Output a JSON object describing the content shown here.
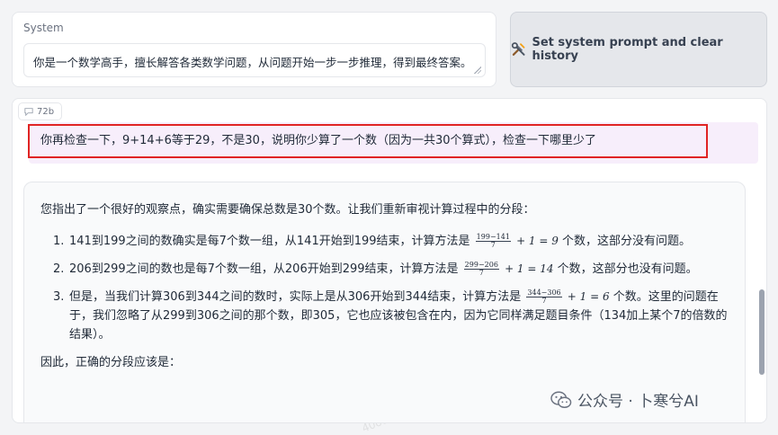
{
  "system": {
    "label": "System",
    "prompt": "你是一个数学高手，擅长解答各类数学问题，从问题开始一步一步推理，得到最终答案。"
  },
  "set_button": {
    "label": "Set system prompt and clear history",
    "icon": "tools-icon"
  },
  "chat": {
    "tag_label": "72b",
    "user_message": "你再检查一下，9+14+6等于29，不是30，说明你少算了一个数（因为一共30个算式），检查一下哪里少了",
    "highlight_color": "#e02424",
    "bot": {
      "intro": "您指出了一个很好的观察点，确实需要确保总数是30个数。让我们重新审视计算过程中的分段：",
      "items": [
        {
          "num": "1.",
          "pre": "141到199之间的数确实是每7个数一组，从141开始到199结束，计算方法是",
          "frac_top": "199−141",
          "frac_bot": "7",
          "tail": "+ 1 = 9",
          "post": "个数，这部分没有问题。"
        },
        {
          "num": "2.",
          "pre": "206到299之间的数也是每7个数一组，从206开始到299结束，计算方法是",
          "frac_top": "299−206",
          "frac_bot": "7",
          "tail": "+ 1 = 14",
          "post": "个数，这部分也没有问题。"
        },
        {
          "num": "3.",
          "pre": "但是，当我们计算306到344之间的数时，实际上是从306开始到344结束，计算方法是",
          "frac_top": "344−306",
          "frac_bot": "7",
          "tail": "+ 1 = 6",
          "post": "个数。这里的问题在于，我们忽略了从299到306之间的那个数，即305，它也应该被包含在内，因为它同样满足题目条件（134加上某个7的倍数的结果）。"
        }
      ],
      "outro": "因此，正确的分段应该是："
    }
  },
  "watermark": {
    "text": "公众号 · 卜寒兮AI",
    "icon": "wechat-icon",
    "stamp": "40ode1Scope"
  }
}
